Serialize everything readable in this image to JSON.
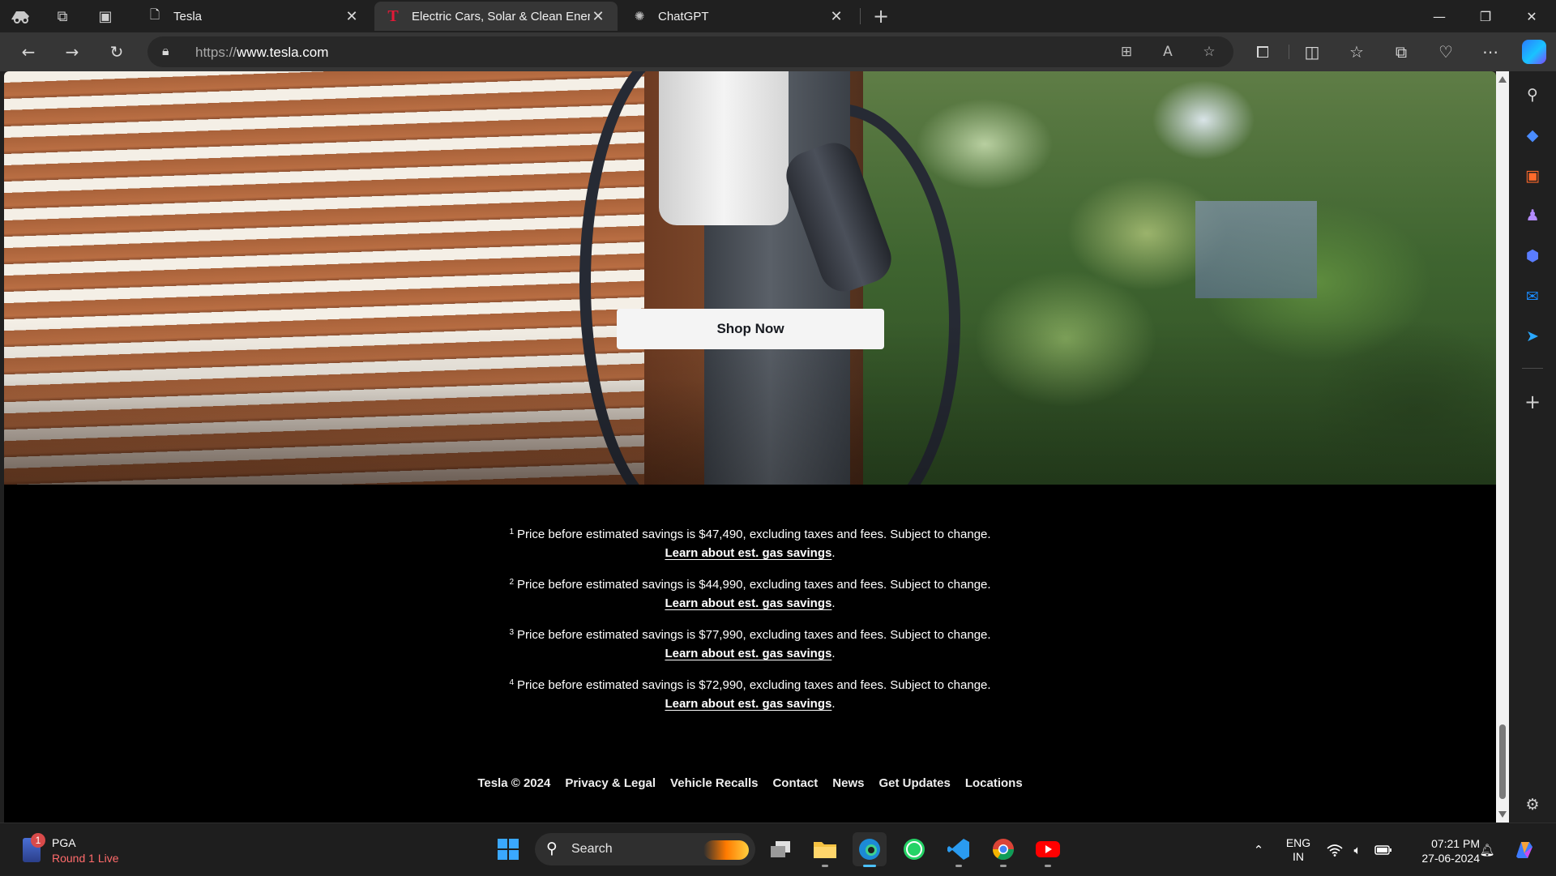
{
  "browser": {
    "tabs": [
      {
        "title": "Tesla",
        "favicon": "page-icon",
        "active": false
      },
      {
        "title": "Electric Cars, Solar & Clean Energ",
        "favicon": "tesla-logo-icon",
        "active": true
      },
      {
        "title": "ChatGPT",
        "favicon": "chatgpt-icon",
        "active": false
      }
    ],
    "close_glyph": "✕",
    "new_tab_glyph": "+",
    "address": {
      "protocol": "https://",
      "host": "www.tesla.com"
    },
    "accent_color": "#e31937"
  },
  "page": {
    "hero": {
      "cta_label": "Shop Now"
    },
    "footnotes": [
      {
        "num": "1",
        "text": "Price before estimated savings is $47,490, excluding taxes and fees. Subject to change.",
        "link": "Learn about est. gas savings",
        "end": "."
      },
      {
        "num": "2",
        "text": "Price before estimated savings is $44,990, excluding taxes and fees. Subject to change.",
        "link": "Learn about est. gas savings",
        "end": "."
      },
      {
        "num": "3",
        "text": "Price before estimated savings is $77,990, excluding taxes and fees. Subject to change.",
        "link": "Learn about est. gas savings",
        "end": "."
      },
      {
        "num": "4",
        "text": "Price before estimated savings is $72,990, excluding taxes and fees. Subject to change.",
        "link": "Learn about est. gas savings",
        "end": "."
      }
    ],
    "footer": [
      "Tesla © 2024",
      "Privacy & Legal",
      "Vehicle Recalls",
      "Contact",
      "News",
      "Get Updates",
      "Locations"
    ]
  },
  "taskbar": {
    "widget": {
      "title": "PGA",
      "subtitle": "Round 1 Live",
      "badge": "1"
    },
    "search_label": "Search",
    "lang": {
      "line1": "ENG",
      "line2": "IN"
    },
    "clock": {
      "time": "07:21 PM",
      "date": "27-06-2024"
    }
  }
}
